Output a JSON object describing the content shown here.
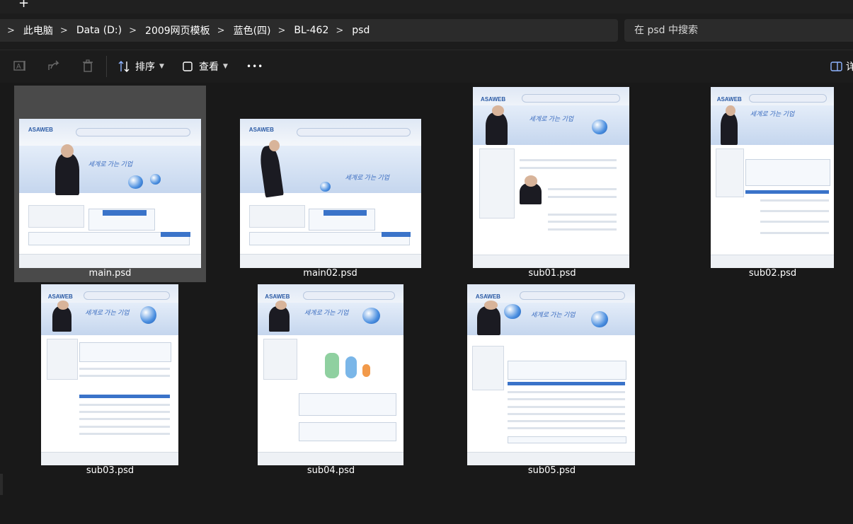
{
  "window": {
    "new_tab_symbol": "+"
  },
  "breadcrumb": {
    "separator": ">",
    "items": [
      "此电脑",
      "Data (D:)",
      "2009网页模板",
      "蓝色(四)",
      "BL-462",
      "psd"
    ]
  },
  "search": {
    "placeholder": "在 psd 中搜索"
  },
  "toolbar": {
    "sort_label": "排序",
    "view_label": "查看",
    "more_label": "•••",
    "details_label": "详"
  },
  "files": [
    {
      "name": "main.psd",
      "selected": true,
      "banner_text": "세계로 가는 기업",
      "logo": "ASAWEB"
    },
    {
      "name": "main02.psd",
      "selected": false,
      "banner_text": "세계로 가는 기업",
      "logo": "ASAWEB"
    },
    {
      "name": "sub01.psd",
      "selected": false,
      "banner_text": "세계로 가는 기업",
      "logo": "ASAWEB"
    },
    {
      "name": "sub02.psd",
      "selected": false,
      "banner_text": "세계로 가는 기업",
      "logo": "ASAWEB"
    },
    {
      "name": "sub03.psd",
      "selected": false,
      "banner_text": "세계로 가는 기업",
      "logo": "ASAWEB"
    },
    {
      "name": "sub04.psd",
      "selected": false,
      "banner_text": "세계로 가는 기업",
      "logo": "ASAWEB"
    },
    {
      "name": "sub05.psd",
      "selected": false,
      "banner_text": "세계로 가는 기업",
      "logo": "ASAWEB"
    }
  ],
  "colors": {
    "background": "#191919",
    "selected_tile": "#4a4a4a",
    "bar": "#2b2b2b",
    "accent": "#3a73c9"
  }
}
